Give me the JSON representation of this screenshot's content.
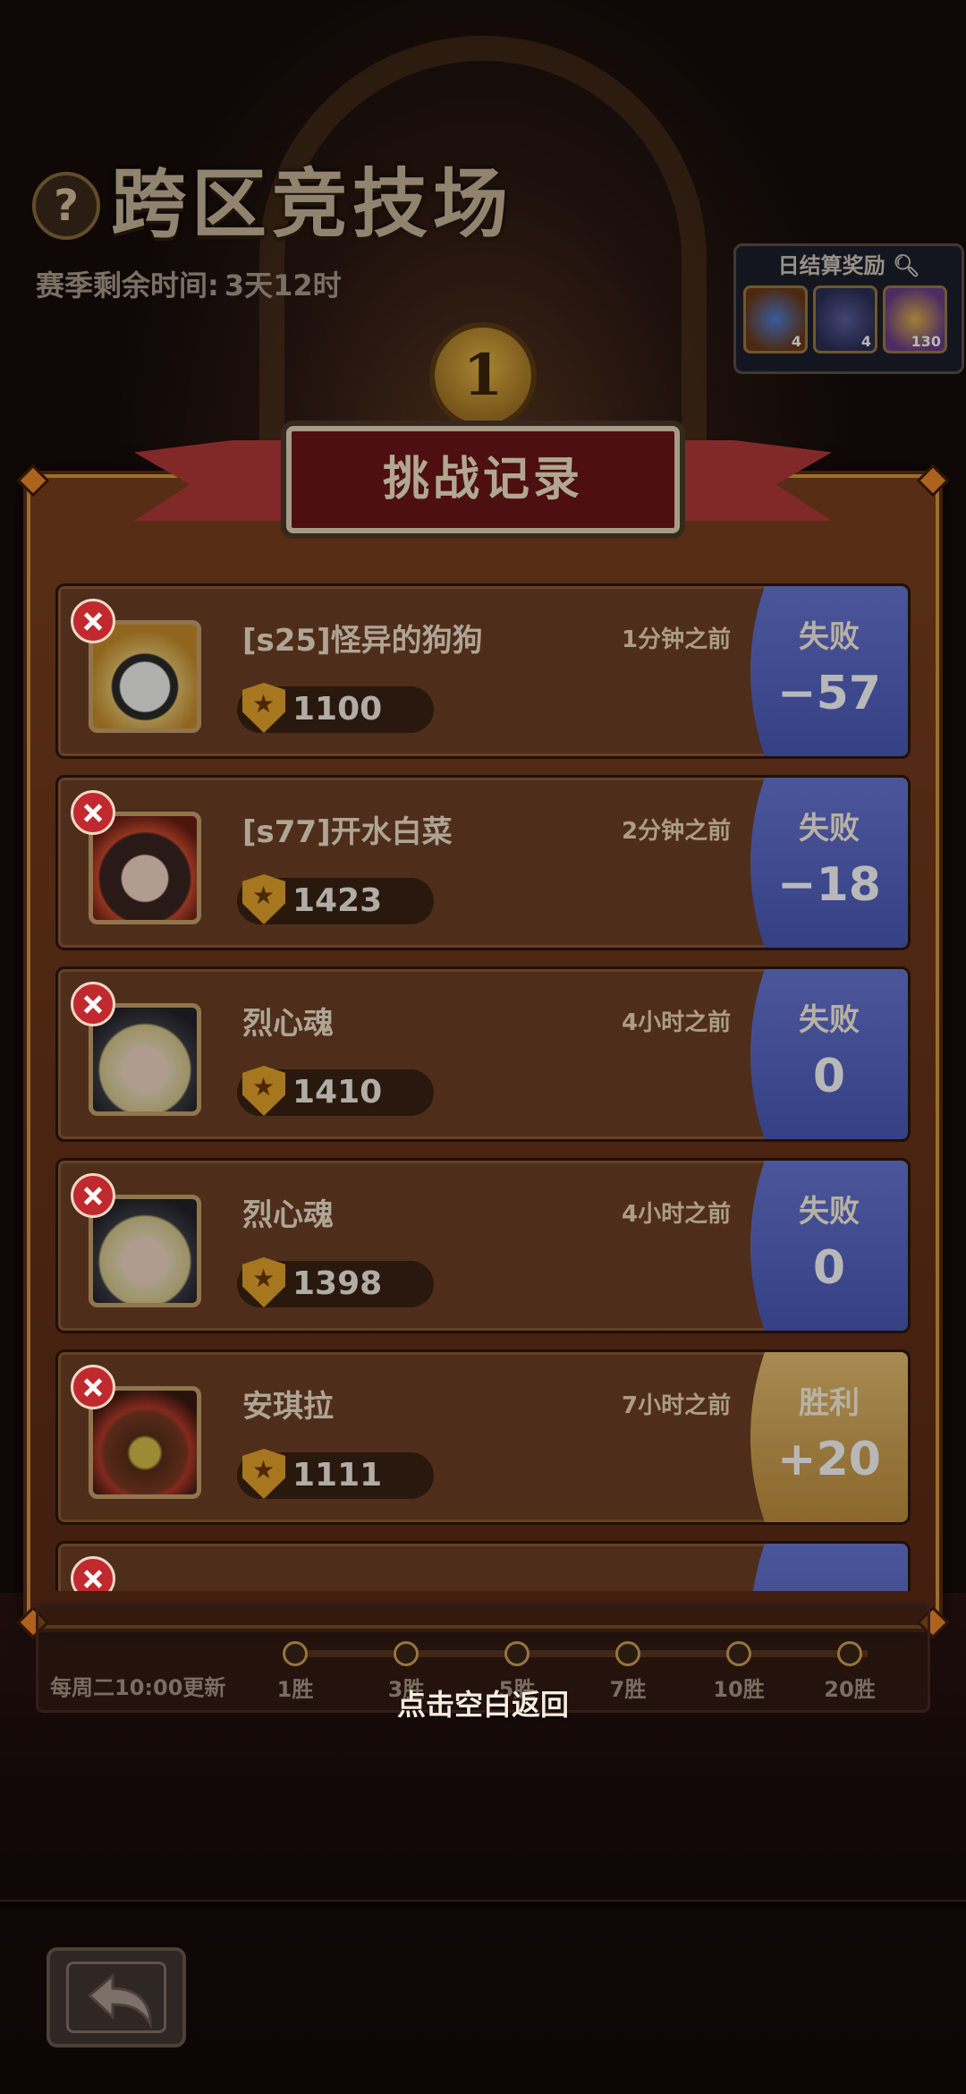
{
  "header": {
    "help_icon": "?",
    "title": "跨区竞技场",
    "season_label": "赛季剩余时间:",
    "season_value": "3天12时"
  },
  "daily_reward": {
    "title": "日结算奖励",
    "items": [
      {
        "icon": "blue-gem-crest-icon",
        "qty": "4"
      },
      {
        "icon": "purple-emblem-icon",
        "qty": "4"
      },
      {
        "icon": "gold-crown-coin-icon",
        "qty": "130"
      }
    ]
  },
  "rank": {
    "value": "1"
  },
  "dialog": {
    "title": "挑战记录",
    "records": [
      {
        "name": "[s25]怪异的狗狗",
        "time": "1分钟之前",
        "score": "1100",
        "result": "失败",
        "delta": "−57",
        "outcome": "lose",
        "avatar": "panda-king-avatar"
      },
      {
        "name": "[s77]开水白菜",
        "time": "2分钟之前",
        "score": "1423",
        "result": "失败",
        "delta": "−18",
        "outcome": "lose",
        "avatar": "fox-girl-avatar"
      },
      {
        "name": "烈心魂",
        "time": "4小时之前",
        "score": "1410",
        "result": "失败",
        "delta": "0",
        "outcome": "lose",
        "avatar": "blonde-hero-avatar"
      },
      {
        "name": "烈心魂",
        "time": "4小时之前",
        "score": "1398",
        "result": "失败",
        "delta": "0",
        "outcome": "lose",
        "avatar": "blonde-hero-avatar"
      },
      {
        "name": "安琪拉",
        "time": "7小时之前",
        "score": "1111",
        "result": "胜利",
        "delta": "+20",
        "outcome": "win",
        "avatar": "cat-warrior-avatar"
      }
    ]
  },
  "weekly": {
    "refresh": "每周二10:00更新",
    "milestones": [
      "1胜",
      "3胜",
      "5胜",
      "7胜",
      "10胜",
      "20胜"
    ]
  },
  "hint": "点击空白返回",
  "colors": {
    "lose": "#5867c8",
    "win": "#d6a756",
    "panel": "#6a3419",
    "accent": "#f08a2a"
  }
}
